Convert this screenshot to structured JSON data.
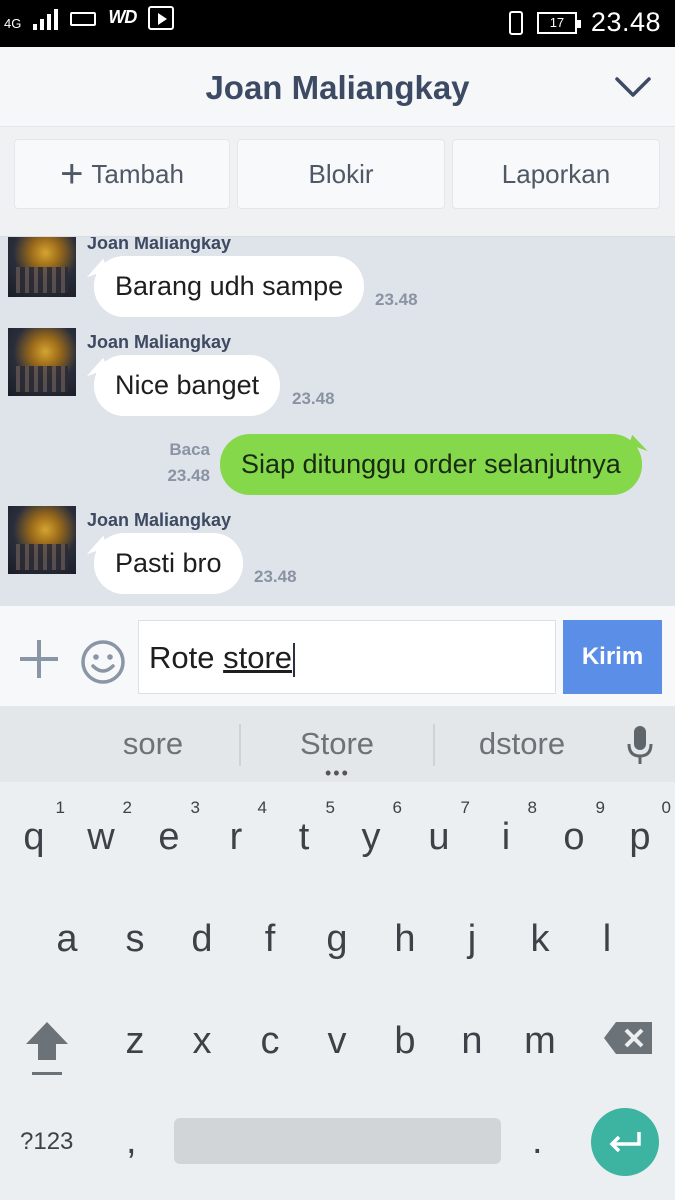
{
  "status_bar": {
    "network": "4G",
    "carrier_logo": "WD",
    "battery": "17",
    "time": "23.48"
  },
  "header": {
    "title": "Joan Maliangkay"
  },
  "actions": {
    "add_label": "Tambah",
    "block_label": "Blokir",
    "report_label": "Laporkan"
  },
  "messages": [
    {
      "sender": "Joan Maliangkay",
      "text": "Barang udh sampe",
      "time": "23.48"
    },
    {
      "sender": "Joan Maliangkay",
      "text": "Nice banget",
      "time": "23.48"
    },
    {
      "read": "Baca",
      "text": "Siap ditunggu order selanjutnya",
      "time": "23.48"
    },
    {
      "sender": "Joan Maliangkay",
      "text": "Pasti bro",
      "time": "23.48"
    }
  ],
  "input": {
    "text_plain": "Rote ",
    "text_underlined": "store",
    "send_label": "Kirim"
  },
  "keyboard": {
    "suggestions": [
      "sore",
      "Store",
      "dstore"
    ],
    "row1": [
      "q",
      "w",
      "e",
      "r",
      "t",
      "y",
      "u",
      "i",
      "o",
      "p"
    ],
    "row1_hints": [
      "1",
      "2",
      "3",
      "4",
      "5",
      "6",
      "7",
      "8",
      "9",
      "0"
    ],
    "row2": [
      "a",
      "s",
      "d",
      "f",
      "g",
      "h",
      "j",
      "k",
      "l"
    ],
    "row3": [
      "z",
      "x",
      "c",
      "v",
      "b",
      "n",
      "m"
    ],
    "symbols_label": "?123",
    "comma": ",",
    "period": "."
  },
  "colors": {
    "outgoing_bubble": "#84d84a",
    "send_button": "#5b8ee6",
    "enter_key": "#3db3a1",
    "header_text": "#3c4a63"
  }
}
